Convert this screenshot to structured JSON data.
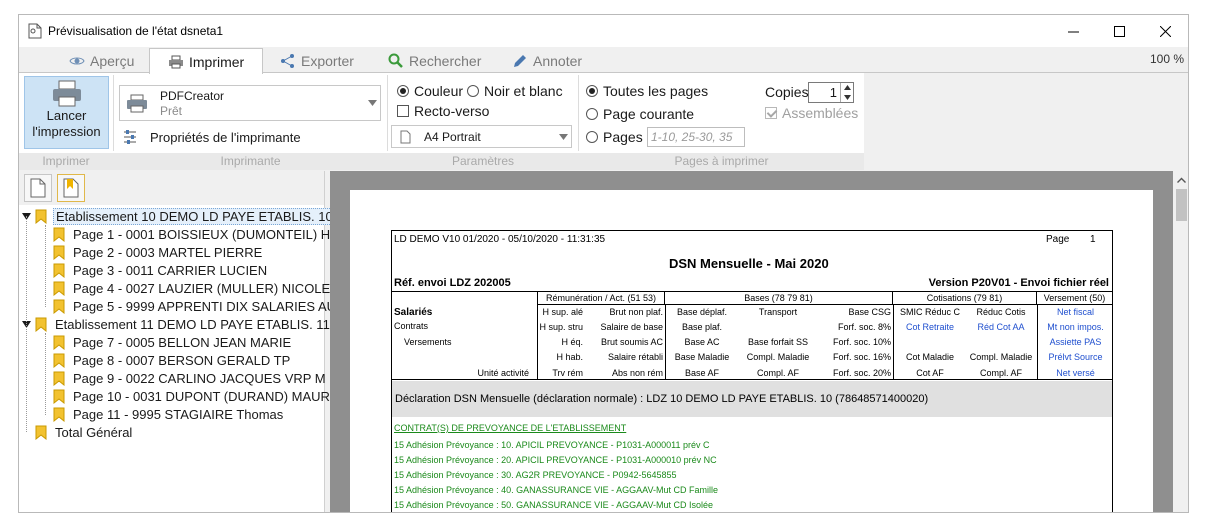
{
  "window": {
    "title": "Prévisualisation de l'état dsneta1"
  },
  "tabs": [
    {
      "label": "Aperçu"
    },
    {
      "label": "Imprimer"
    },
    {
      "label": "Exporter"
    },
    {
      "label": "Rechercher"
    },
    {
      "label": "Annoter"
    }
  ],
  "zoom": "100 %",
  "ribbon": {
    "print_button": {
      "line1": "Lancer",
      "line2": "l'impression"
    },
    "printer": {
      "name": "PDFCreator",
      "status": "Prêt"
    },
    "printer_props": "Propriétés de l'imprimante",
    "color": "Couleur",
    "bw": "Noir et blanc",
    "duplex": "Recto-verso",
    "paper": "A4 Portrait",
    "all_pages": "Toutes les pages",
    "current_page": "Page courante",
    "pages": "Pages",
    "pages_placeholder": "1-10, 25-30, 35",
    "copies_label": "Copies",
    "copies_value": "1",
    "collate": "Assemblées",
    "groups": {
      "print": "Imprimer",
      "printer": "Imprimante",
      "params": "Paramètres",
      "pages": "Pages à imprimer"
    }
  },
  "tree": {
    "nodes": [
      {
        "label": "Etablissement 10 DEMO LD PAYE ETABLIS. 10"
      },
      {
        "label": "Page 1 - 0001 BOISSIEUX (DUMONTEIL) HE"
      },
      {
        "label": "Page 2 - 0003 MARTEL PIERRE"
      },
      {
        "label": "Page 3 - 0011 CARRIER LUCIEN"
      },
      {
        "label": "Page 4 - 0027 LAUZIER (MULLER) NICOLE"
      },
      {
        "label": "Page 5 - 9999 APPRENTI DIX SALARIES AU"
      },
      {
        "label": "Etablissement 11 DEMO LD PAYE ETABLIS. 11"
      },
      {
        "label": "Page 7 - 0005 BELLON JEAN MARIE"
      },
      {
        "label": "Page 8 - 0007 BERSON GERALD TP"
      },
      {
        "label": "Page 9 - 0022 CARLINO JACQUES VRP M"
      },
      {
        "label": "Page 10 - 0031 DUPONT (DURAND) MAUR"
      },
      {
        "label": "Page 11 - 9995 STAGIAIRE Thomas"
      },
      {
        "label": "Total Général"
      }
    ]
  },
  "report": {
    "header_left": "LD DEMO V10 01/2020 - 05/10/2020 - 11:31:35",
    "page_label": "Page",
    "page_no": "1",
    "title": "DSN Mensuelle - Mai 2020",
    "ref": "Réf. envoi LDZ 202005",
    "version": "Version P20V01  -  Envoi fichier réel",
    "col_headers": {
      "remun": "Rémunération / Act. (51 53)",
      "bases": "Bases (78 79 81)",
      "cotis": "Cotisations (79 81)",
      "versement": "Versement (50)"
    },
    "left_labels": {
      "salaries": "Salariés",
      "contrats": "Contrats",
      "versements": "Versements",
      "unite": "Unité activité"
    },
    "remun_a": [
      "H sup. alé",
      "H sup. stru",
      "H éq.",
      "H hab.",
      "Trv rém"
    ],
    "remun_b": [
      "Brut non plaf.",
      "Salaire de base",
      "Brut soumis AC",
      "Salaire rétabli",
      "Abs non rém"
    ],
    "bases_a": [
      "Base déplaf.",
      "Base plaf.",
      "Base AC",
      "Base Maladie",
      "Base AF"
    ],
    "bases_b": [
      "Transport",
      "",
      "Base forfait SS",
      "Compl. Maladie",
      "Compl. AF"
    ],
    "bases_c": [
      "Base CSG",
      "Forf. soc. 8%",
      "Forf. soc. 10%",
      "Forf. soc. 16%",
      "Forf. soc. 20%"
    ],
    "cotis_a": [
      "SMIC Réduc C",
      "Cot Retraite",
      "",
      "Cot Maladie",
      "Cot AF"
    ],
    "cotis_b": [
      "Réduc Cotis",
      "Réd Cot AA",
      "",
      "Compl. Maladie",
      "Compl. AF"
    ],
    "versement": [
      "Net fiscal",
      "Mt non impos.",
      "Assiette PAS",
      "Prélvt Source",
      "Net versé"
    ],
    "declaration": "Déclaration DSN Mensuelle (déclaration normale) : LDZ 10 DEMO LD PAYE ETABLIS. 10 (78648571400020)",
    "contracts_title": "CONTRAT(S) DE PREVOYANCE DE L'ETABLISSEMENT",
    "contract_lines": [
      "15 Adhésion Prévoyance : 10. APICIL PREVOYANCE - P1031-A000011 prév C",
      "15 Adhésion Prévoyance : 20. APICIL PREVOYANCE - P1031-A000010 prév NC",
      "15 Adhésion Prévoyance : 30. AG2R PREVOYANCE - P0942-5645855",
      "15 Adhésion Prévoyance : 40. GANASSURANCE VIE - AGGAAV-Mut CD Famille",
      "15 Adhésion Prévoyance : 50. GANASSURANCE VIE - AGGAAV-Mut CD Isolée"
    ]
  }
}
